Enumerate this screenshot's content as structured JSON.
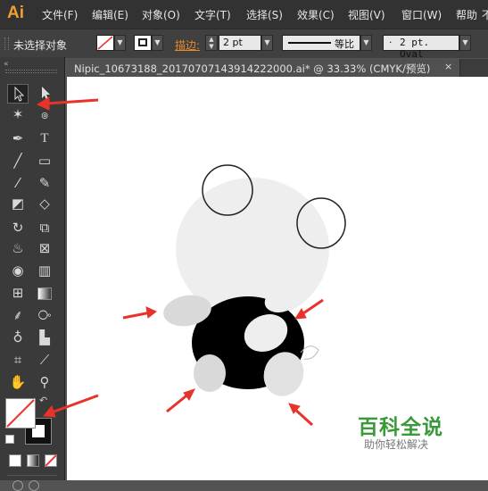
{
  "app": {
    "logo": "Ai"
  },
  "menu": [
    "文件(F)",
    "编辑(E)",
    "对象(O)",
    "文字(T)",
    "选择(S)",
    "效果(C)",
    "视图(V)",
    "窗口(W)",
    "帮助"
  ],
  "menu_overflow": "不",
  "control_bar": {
    "selection_status": "未选择对象",
    "stroke_label": "描边:",
    "stroke_weight": "2 pt",
    "profile": "等比",
    "brush": "2 pt. Oval",
    "accent_label_color": "#e88a2b"
  },
  "document_tab": {
    "title": "Nipic_10673188_20170707143914222000.ai*  @  33.33%  (CMYK/预览)",
    "close": "×"
  },
  "tools": {
    "left": [
      "selection-icon",
      "magic-wand-icon",
      "pen-icon",
      "line-icon",
      "paintbrush-icon",
      "shaper-icon",
      "rotate-icon",
      "warp-icon",
      "shape-builder-icon",
      "mesh-icon",
      "eyedropper-icon",
      "symbol-sprayer-icon",
      "artboard-icon",
      "hand-icon"
    ],
    "right": [
      "direct-selection-icon",
      "lasso-icon",
      "type-icon",
      "rectangle-icon",
      "pencil-icon",
      "eraser-icon",
      "scale-icon",
      "free-transform-icon",
      "perspective-grid-icon",
      "gradient-icon",
      "blend-icon",
      "column-graph-icon",
      "slice-icon",
      "zoom-icon"
    ]
  },
  "watermark": {
    "title": "百科全说",
    "subtitle": "助你轻松解决"
  },
  "colors": {
    "arrow": "#e8332a",
    "watermark_green": "#3a9a3a",
    "panda_gray": "#eeeeee",
    "limb_gray": "#d9d9d9"
  }
}
